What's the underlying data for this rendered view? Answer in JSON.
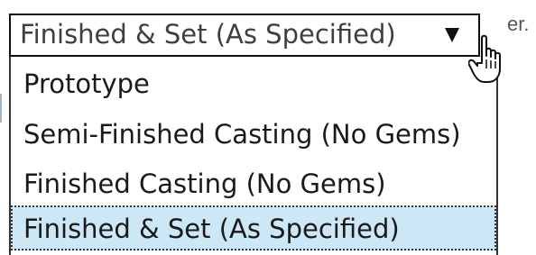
{
  "select": {
    "value": "Finished & Set (As Specified)",
    "arrow_icon": "triangle-down-icon"
  },
  "options": [
    {
      "label": "Prototype"
    },
    {
      "label": "Semi-Finished Casting (No Gems)"
    },
    {
      "label": "Finished Casting (No Gems)"
    },
    {
      "label": "Finished & Set (As Specified)",
      "selected": true
    }
  ],
  "background_text": "er.",
  "cursor_icon": "hand-pointer-icon",
  "colors": {
    "highlight": "#cce8f6",
    "border": "#111111",
    "text": "#1a1a1a"
  }
}
